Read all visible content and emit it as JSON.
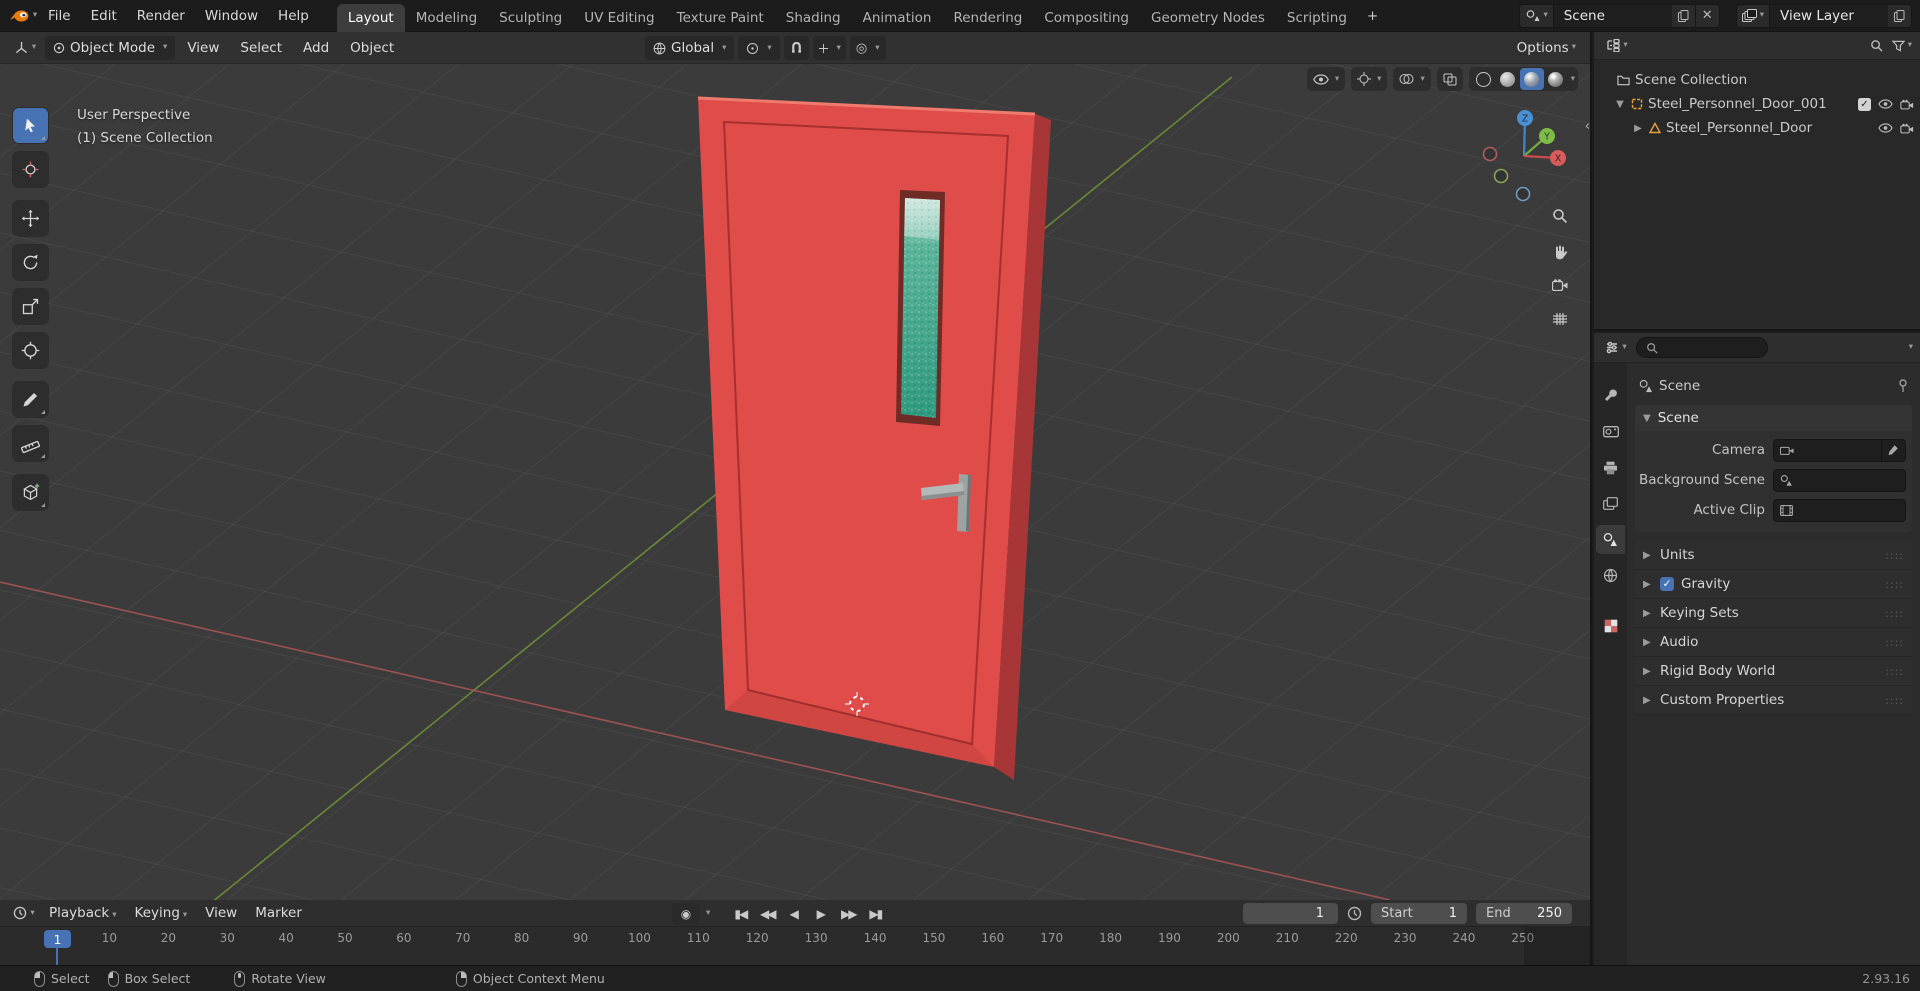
{
  "topbar": {
    "menus": [
      {
        "label": "File"
      },
      {
        "label": "Edit"
      },
      {
        "label": "Render"
      },
      {
        "label": "Window"
      },
      {
        "label": "Help"
      }
    ],
    "workspaces": [
      {
        "label": "Layout",
        "active": true
      },
      {
        "label": "Modeling"
      },
      {
        "label": "Sculpting"
      },
      {
        "label": "UV Editing"
      },
      {
        "label": "Texture Paint"
      },
      {
        "label": "Shading"
      },
      {
        "label": "Animation"
      },
      {
        "label": "Rendering"
      },
      {
        "label": "Compositing"
      },
      {
        "label": "Geometry Nodes"
      },
      {
        "label": "Scripting"
      }
    ],
    "add_workspace_label": "+",
    "scene_field": {
      "value": "Scene"
    },
    "view_layer_field": {
      "value": "View Layer"
    }
  },
  "viewport_header": {
    "mode": "Object Mode",
    "menus": [
      {
        "label": "View"
      },
      {
        "label": "Select"
      },
      {
        "label": "Add"
      },
      {
        "label": "Object"
      }
    ],
    "orientation": "Global",
    "options_label": "Options"
  },
  "viewport": {
    "overlay_line1": "User Perspective",
    "overlay_line2": "(1) Scene Collection",
    "axis_labels": {
      "x": "X",
      "y": "Y",
      "z": "Z"
    }
  },
  "outliner": {
    "rows": [
      {
        "label": "Scene Collection"
      },
      {
        "label": "Steel_Personnel_Door_001"
      },
      {
        "label": "Steel_Personnel_Door"
      }
    ]
  },
  "properties": {
    "breadcrumb": "Scene",
    "panel_scene": {
      "title": "Scene",
      "fields": [
        {
          "label": "Camera"
        },
        {
          "label": "Background Scene"
        },
        {
          "label": "Active Clip"
        }
      ]
    },
    "panels": [
      {
        "label": "Units"
      },
      {
        "label": "Gravity",
        "checked": true
      },
      {
        "label": "Keying Sets"
      },
      {
        "label": "Audio"
      },
      {
        "label": "Rigid Body World"
      },
      {
        "label": "Custom Properties"
      }
    ]
  },
  "timeline": {
    "menus": [
      {
        "label": "Playback"
      },
      {
        "label": "Keying"
      },
      {
        "label": "View"
      },
      {
        "label": "Marker"
      }
    ],
    "current_frame": "1",
    "frame_display": "1",
    "start_label": "Start",
    "start_value": "1",
    "end_label": "End",
    "end_value": "250",
    "ticks": [
      "10",
      "20",
      "30",
      "40",
      "50",
      "60",
      "70",
      "80",
      "90",
      "100",
      "110",
      "120",
      "130",
      "140",
      "150",
      "160",
      "170",
      "180",
      "190",
      "200",
      "210",
      "220",
      "230",
      "240",
      "250"
    ]
  },
  "statusbar": {
    "hints": [
      {
        "label": "Select"
      },
      {
        "label": "Box Select"
      },
      {
        "label": "Rotate View"
      },
      {
        "label": "Object Context Menu"
      }
    ],
    "version": "2.93.16"
  },
  "colors": {
    "accent": "#4772b3",
    "door_front": "#df4c49",
    "door_side": "#a83636",
    "glass": "#43a78c",
    "axis_x": "#b25858",
    "axis_y": "#729636",
    "axis_z": "#3f87c9",
    "object_icon_orange": "#e8a33d"
  }
}
